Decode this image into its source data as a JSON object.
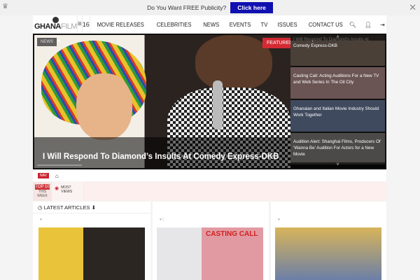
{
  "topbar": {
    "promo_text": "Do You Want FREE Publicity?",
    "cta_label": "Click here"
  },
  "nav": {
    "logo_text": "GHANA",
    "logo_text2": "FILM",
    "date": "16",
    "items": [
      "MOVIE RELEASES",
      "CELEBRITIES",
      "NEWS",
      "EVENTS",
      "TV",
      "ISSUES",
      "CONTACT US"
    ]
  },
  "hero": {
    "category": "NEWS",
    "featured_label": "FEATURED",
    "title": "I Will Respond To Diamond’s Insults At Comedy Express-DKB",
    "side_items": [
      "I Will Respond To Diamond’s Insults At Comedy Express-DKB",
      "Casting Call: Acting Auditions For a New TV and Web Series In The Oil City",
      "Ghanaian and Italian Movie Industry Should Work Together",
      "Audition Alert: Shanghai Films, Producers Of ‘Wanna Be’ Audition For Actors for a New Movie"
    ]
  },
  "breadcrumb": {
    "nav_label": "NAV"
  },
  "tabs": {
    "top10": "TOP 10",
    "this_week": "THIS WEEK",
    "most_views": "MOST VIEWS"
  },
  "columns": {
    "latest_label": "LATEST ARTICLES",
    "casting_text": "CASTING CALL"
  }
}
